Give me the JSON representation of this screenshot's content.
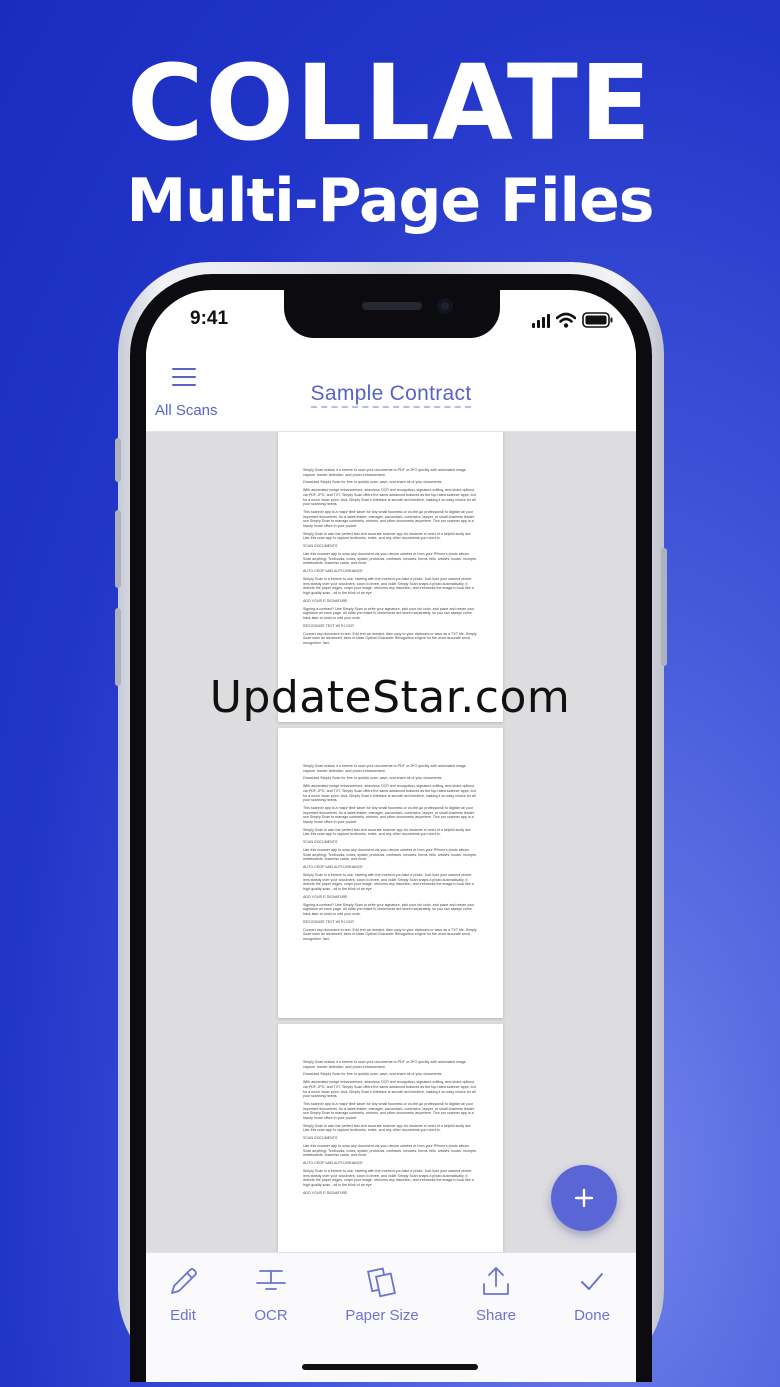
{
  "promo": {
    "headline": "COLLATE",
    "subheadline": "Multi-Page Files"
  },
  "status_bar": {
    "time": "9:41"
  },
  "nav": {
    "menu_label": "All Scans",
    "document_title": "Sample Contract"
  },
  "document_pages": [
    {
      "paragraphs": [
        "Simply Scan makes it a breeze to scan your documents to PDF or JPG quickly with automated image capture, border detection, and photo enhancement.",
        "Download Simply Scan for free to quickly scan, save, and share all of your documents.",
        "With automated image enhancement, seamless OCR text recognition, signature editing, and share options via PDF, JPG, and TXT, Simply Scan offers the same advanced features as the top-rated scanner apps, but for a much lower price. And, Simply Scan's interface is smooth and intuitive, making it an easy choice for all your scanning needs.",
        "This scanner app is a major time saver for any small business or on-the-go professional to digitize all your important documents. As a sales leader, manager, accountant, contractor, lawyer, or small business leader, use Simply Scan to manage contracts, memos, and other documents anywhere. This pro scanner app is a handy home office in your pocket.",
        "Simply Scan is also the perfect fast and accurate scanner app for students in need of a helpful study aid. Use this scan app to capture textbooks, notes, and any other documents you need to.",
        "SCAN DOCUMENTS",
        "Use this scanner app to scan any document via your device camera or from your iPhone's photo album. Scan anything: Textbooks, notes, syllabi, protocols, contracts, invoices, forms, bills, articles, books, receipts, whiteboards, business cards, and more.",
        "AUTO-CROP AND AUTO-ENHANCE",
        "Simply Scan is a breeze to use, starting with the moment you take a photo. Just hold your camera phone lens steady over your document, count to three, and voila! Simply Scan snaps a photo automatically. It detects the paper edges, crops your image, removes any distortion, and enhances the image to look like a high-quality scan - all in the blink of an eye.",
        "ADD YOUR E-SIGNATURE",
        "Signing a contract? Use Simply Scan to write your signature, pick your ink color, and place and resize your signature on each page. All edits you make to documents are stored separately, so you can always come back later to undo or edit your work.",
        "RECOGNIZE TEXT WITH OCR",
        "Convert any document to text. Edit text as needed, then copy to your clipboard or save as a TXT file. Simply Scan uses an advanced, best-in-class Optical Character Recognition engine for the most accurate word recognition, fast."
      ]
    },
    {
      "paragraphs": [
        "Simply Scan makes it a breeze to scan your documents to PDF or JPG quickly with automated image capture, border detection, and photo enhancement.",
        "Download Simply Scan for free to quickly scan, save, and share all of your documents.",
        "With automated image enhancement, seamless OCR text recognition, signature editing, and share options via PDF, JPG, and TXT, Simply Scan offers the same advanced features as the top-rated scanner apps, but for a much lower price. And, Simply Scan's interface is smooth and intuitive, making it an easy choice for all your scanning needs.",
        "This scanner app is a major time saver for any small business or on-the-go professional to digitize all your important documents. As a sales leader, manager, accountant, contractor, lawyer, or small business leader, use Simply Scan to manage contracts, memos, and other documents anywhere. This pro scanner app is a handy home office in your pocket.",
        "Simply Scan is also the perfect fast and accurate scanner app for students in need of a helpful study aid. Use this scan app to capture textbooks, notes, and any other documents you need to.",
        "SCAN DOCUMENTS",
        "Use this scanner app to scan any document via your device camera or from your iPhone's photo album. Scan anything: Textbooks, notes, syllabi, protocols, contracts, invoices, forms, bills, articles, books, receipts, whiteboards, business cards, and more.",
        "AUTO-CROP AND AUTO-ENHANCE",
        "Simply Scan is a breeze to use, starting with the moment you take a photo. Just hold your camera phone lens steady over your document, count to three, and voila! Simply Scan snaps a photo automatically. It detects the paper edges, crops your image, removes any distortion, and enhances the image to look like a high-quality scan - all in the blink of an eye.",
        "ADD YOUR E-SIGNATURE",
        "Signing a contract? Use Simply Scan to write your signature, pick your ink color, and place and resize your signature on each page. All edits you make to documents are stored separately, so you can always come back later to undo or edit your work.",
        "RECOGNIZE TEXT WITH OCR",
        "Convert any document to text. Edit text as needed, then copy to your clipboard or save as a TXT file. Simply Scan uses an advanced, best-in-class Optical Character Recognition engine for the most accurate word recognition, fast."
      ]
    },
    {
      "paragraphs": [
        "Simply Scan makes it a breeze to scan your documents to PDF or JPG quickly with automated image capture, border detection, and photo enhancement.",
        "Download Simply Scan for free to quickly scan, save, and share all of your documents.",
        "With automated image enhancement, seamless OCR text recognition, signature editing, and share options via PDF, JPG, and TXT, Simply Scan offers the same advanced features as the top-rated scanner apps, but for a much lower price. And, Simply Scan's interface is smooth and intuitive, making it an easy choice for all your scanning needs.",
        "This scanner app is a major time saver for any small business or on-the-go professional to digitize all your important documents. As a sales leader, manager, accountant, contractor, lawyer, or small business leader, use Simply Scan to manage contracts, memos, and other documents anywhere. This pro scanner app is a handy home office in your pocket.",
        "Simply Scan is also the perfect fast and accurate scanner app for students in need of a helpful study aid. Use this scan app to capture textbooks, notes, and any other documents you need to.",
        "SCAN DOCUMENTS",
        "Use this scanner app to scan any document via your device camera or from your iPhone's photo album. Scan anything: Textbooks, notes, syllabi, protocols, contracts, invoices, forms, bills, articles, books, receipts, whiteboards, business cards, and more.",
        "AUTO-CROP AND AUTO-ENHANCE",
        "Simply Scan is a breeze to use, starting with the moment you take a photo. Just hold your camera phone lens steady over your document, count to three, and voila! Simply Scan snaps a photo automatically. It detects the paper edges, crops your image, removes any distortion, and enhances the image to look like a high-quality scan - all in the blink of an eye.",
        "ADD YOUR E-SIGNATURE"
      ]
    }
  ],
  "toolbar": {
    "edit": "Edit",
    "ocr": "OCR",
    "paper_size": "Paper Size",
    "share": "Share",
    "done": "Done"
  },
  "watermark": "UpdateStar.com",
  "icons": {
    "menu": "hamburger-icon",
    "fab": "plus-icon",
    "edit": "pencil-icon",
    "ocr": "text-scan-icon",
    "paper_size": "pages-icon",
    "share": "share-icon",
    "done": "checkmark-icon",
    "signal": "cellular-signal-icon",
    "wifi": "wifi-icon",
    "battery": "battery-icon"
  },
  "colors": {
    "accent": "#5863c8",
    "background": "#2235c9",
    "fab": "#5b66d6"
  }
}
